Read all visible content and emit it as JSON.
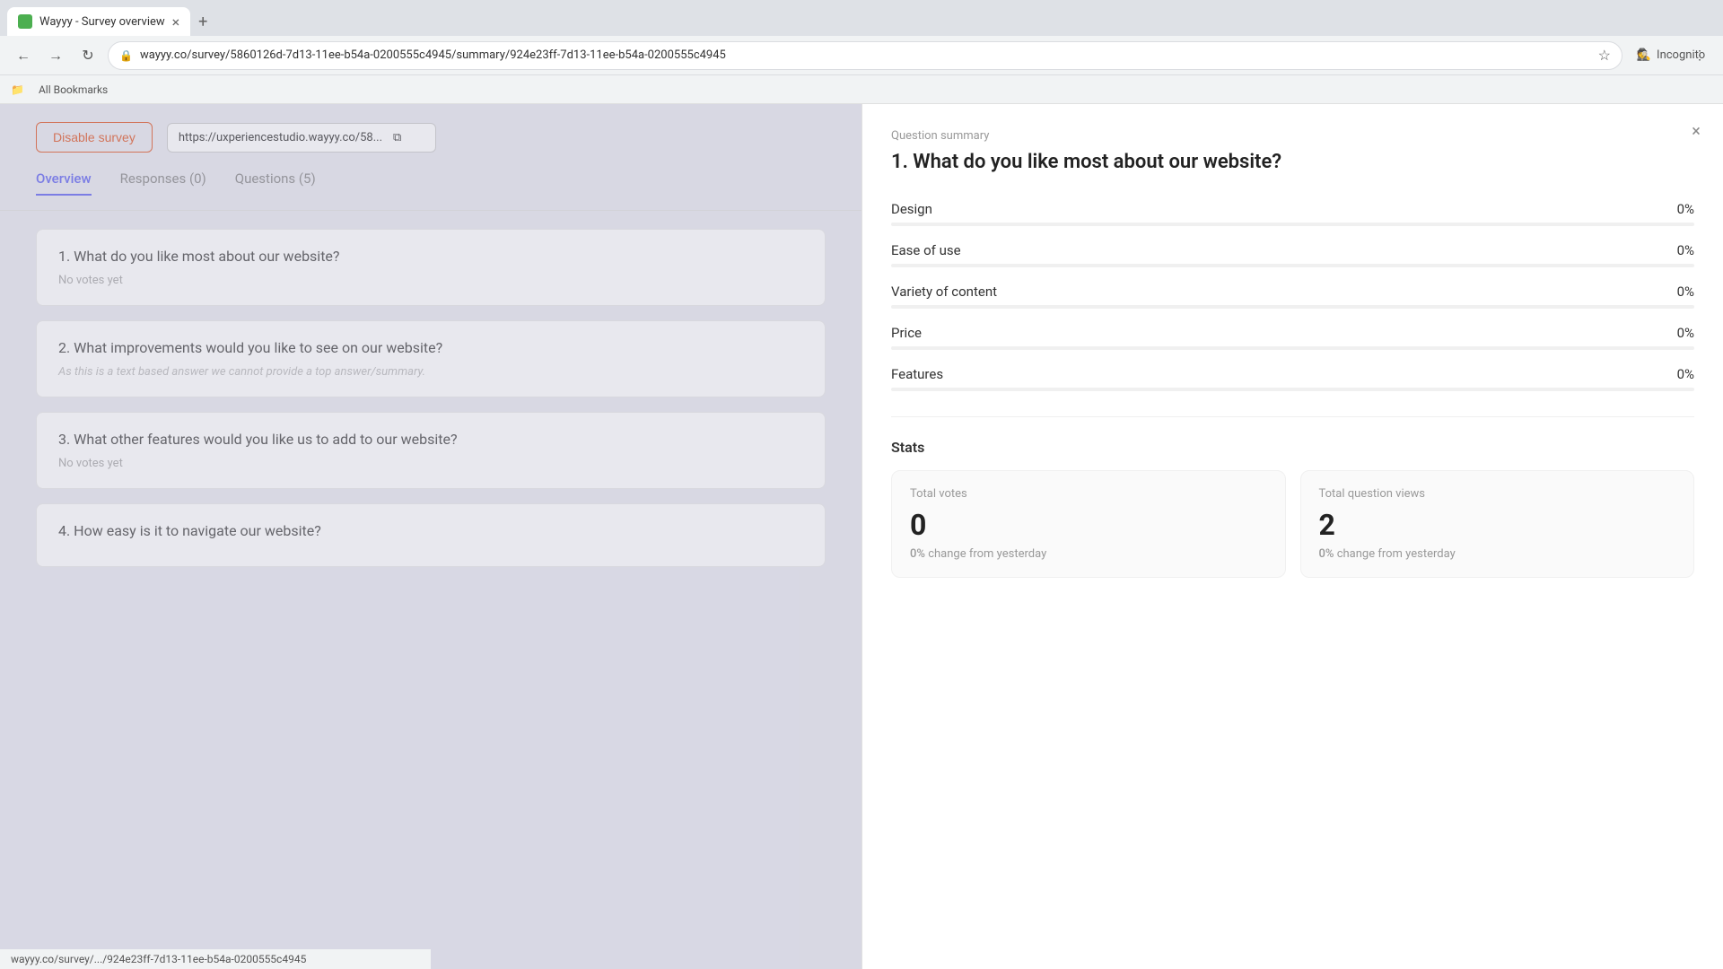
{
  "browser": {
    "tab_title": "Wayyy - Survey overview",
    "tab_close": "×",
    "tab_new": "+",
    "address": "wayyy.co/survey/5860126d-7d13-11ee-b54a-0200555c4945/summary/924e23ff-7d13-11ee-b54a-0200555c4945",
    "incognito_label": "Incognito",
    "bookmarks_label": "All Bookmarks",
    "status_url": "wayyy.co/survey/.../924e23ff-7d13-11ee-b54a-0200555c4945"
  },
  "left": {
    "disable_survey_btn": "Disable survey",
    "survey_url": "https://uxperiencestudio.wayyy.co/58...",
    "tabs": [
      {
        "label": "Overview",
        "active": true
      },
      {
        "label": "Responses (0)",
        "active": false
      },
      {
        "label": "Questions (5)",
        "active": false
      }
    ],
    "questions": [
      {
        "text": "1. What do you like most about our website?",
        "sub": "No votes yet"
      },
      {
        "text": "2. What improvements would you like to see on our website?",
        "sub": "As this is a text based answer we cannot provide a top answer/summary."
      },
      {
        "text": "3. What other features would you like us to add to our website?",
        "sub": "No votes yet"
      },
      {
        "text": "4. How easy is it to navigate our website?",
        "sub": ""
      }
    ]
  },
  "right": {
    "question_summary_label": "Question summary",
    "question_title": "1. What do you like most about our website?",
    "options": [
      {
        "label": "Design",
        "pct": "0%",
        "fill": 0
      },
      {
        "label": "Ease of use",
        "pct": "0%",
        "fill": 0
      },
      {
        "label": "Variety of content",
        "pct": "0%",
        "fill": 0
      },
      {
        "label": "Price",
        "pct": "0%",
        "fill": 0
      },
      {
        "label": "Features",
        "pct": "0%",
        "fill": 0
      }
    ],
    "stats": {
      "title": "Stats",
      "total_votes_label": "Total votes",
      "total_votes_value": "0",
      "total_votes_change": "0% change from yesterday",
      "total_views_label": "Total question views",
      "total_views_value": "2",
      "total_views_change": "0% change from yesterday"
    },
    "close_btn": "×"
  }
}
